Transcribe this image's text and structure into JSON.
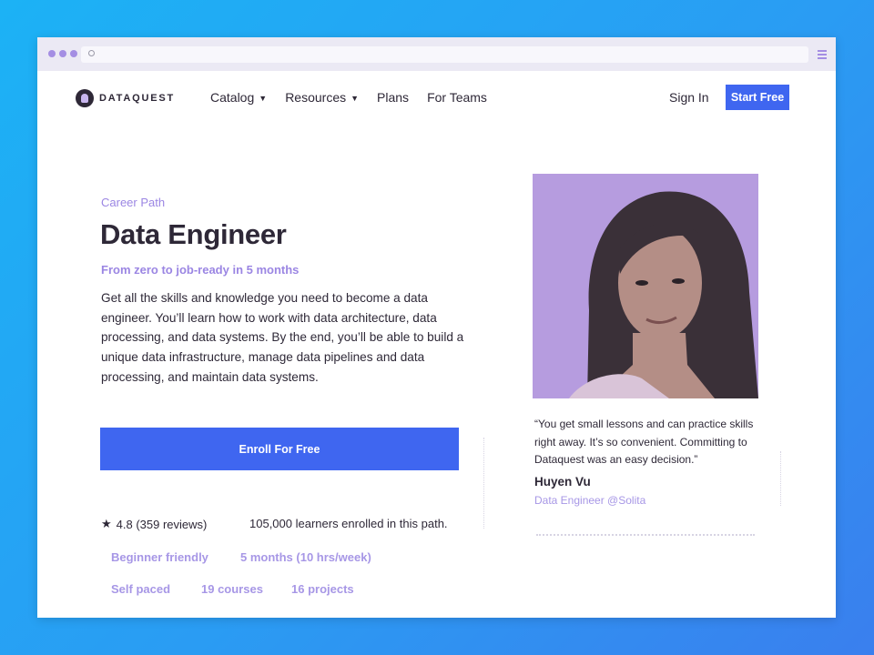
{
  "nav": {
    "logo": "DATAQUEST",
    "links": [
      {
        "label": "Catalog",
        "caret": "▼"
      },
      {
        "label": "Resources",
        "caret": "▼"
      },
      {
        "label": "Plans"
      },
      {
        "label": "For Teams"
      }
    ],
    "sign_in": "Sign In",
    "start_free": "Start Free"
  },
  "hero": {
    "eyebrow": "Career Path",
    "title": "Data Engineer",
    "subtitle": "From zero to job-ready in 5 months",
    "description": "Get all the skills and knowledge you need to become a data engineer. You’ll learn how to work with data architecture, data processing, and data systems. By the end, you’ll be able to build a unique data infrastructure, manage data pipelines and data processing, and maintain data systems.",
    "enroll_label": "Enroll For Free",
    "rating_star": "★",
    "rating": "4.8 (359 reviews)",
    "enrolled": "105,000 learners enrolled in this path.",
    "tags": [
      "Beginner friendly",
      "5 months (10 hrs/week)",
      "Self paced",
      "19 courses",
      "16 projects"
    ]
  },
  "testimonial": {
    "quote": "“You get small lessons and can practice skills right away. It’s so convenient. Committing to Dataquest was an easy decision.”",
    "name": "Huyen Vu",
    "role": "Data Engineer @Solita"
  },
  "colors": {
    "background": "#1cb2f5",
    "accent": "#3f66f0",
    "purple": "#9b86e3",
    "photo_bg": "#b69cdf",
    "text": "#2e2837"
  },
  "icons": [
    "logo-icon",
    "caret-down-icon",
    "star-icon",
    "reload-icon",
    "menu-icon"
  ]
}
